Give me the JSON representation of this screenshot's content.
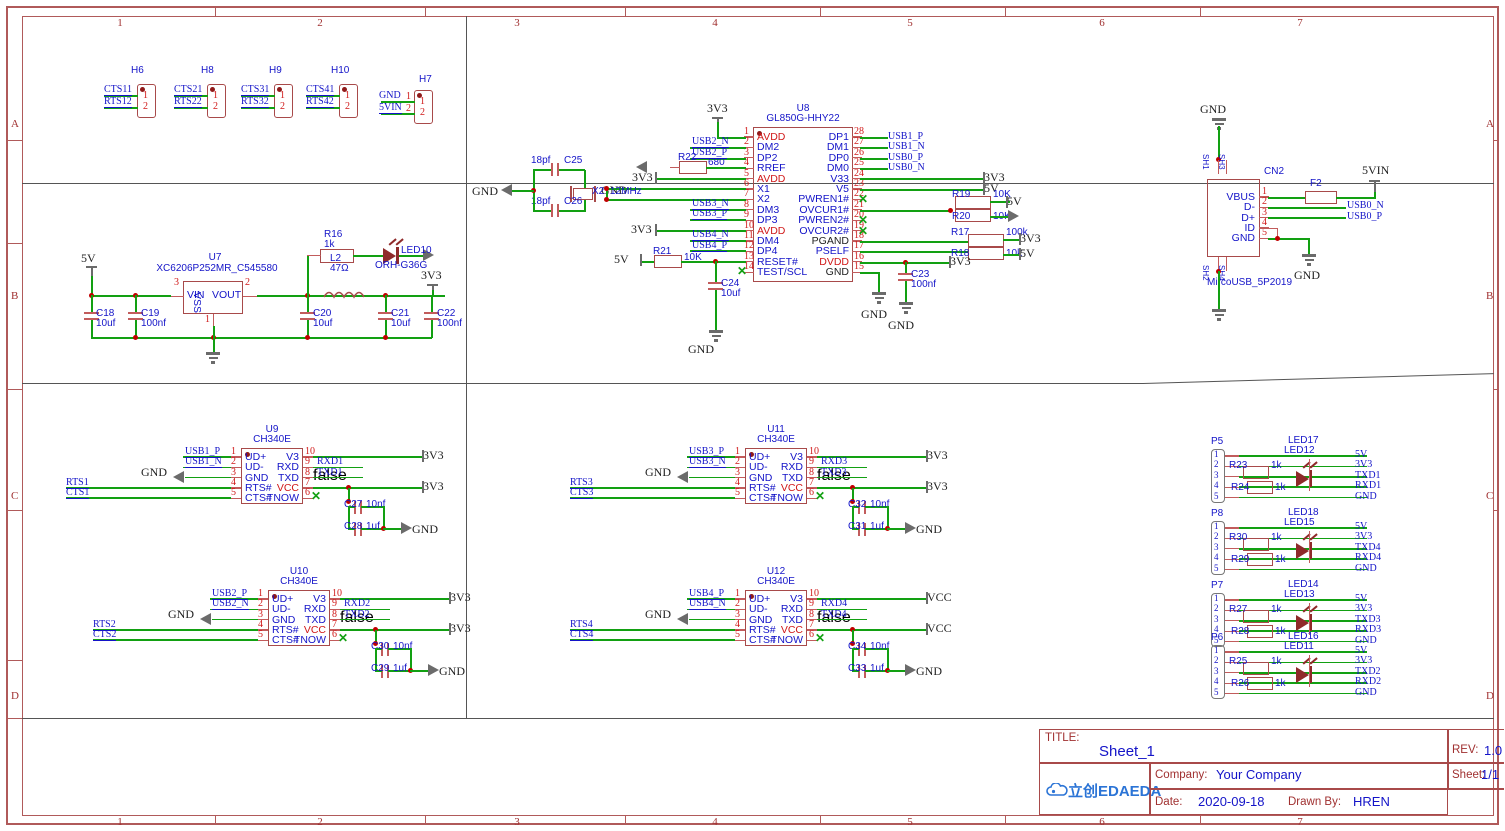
{
  "sheet": {
    "columns": [
      "1",
      "2",
      "3",
      "4",
      "5",
      "6",
      "7"
    ],
    "rows": [
      "A",
      "B",
      "C",
      "D"
    ]
  },
  "title_block": {
    "title_key": "TITLE:",
    "title_value": "Sheet_1",
    "rev_key": "REV:",
    "rev_value": "1.0",
    "company_key": "Company:",
    "company_value": "Your Company",
    "sheet_key": "Sheet:",
    "sheet_value": "1/1",
    "date_key": "Date:",
    "date_value": "2020-09-18",
    "drawn_key": "Drawn By:",
    "drawn_value": "HREN",
    "logo": "立创EDA"
  },
  "headers": [
    {
      "ref": "H6",
      "net_top": "CTS11",
      "net_bot": "RTS12",
      "pin1": "1",
      "pin2": "2"
    },
    {
      "ref": "H8",
      "net_top": "CTS21",
      "net_bot": "RTS22",
      "pin1": "1",
      "pin2": "2"
    },
    {
      "ref": "H9",
      "net_top": "CTS31",
      "net_bot": "RTS32",
      "pin1": "1",
      "pin2": "2"
    },
    {
      "ref": "H10",
      "net_top": "CTS41",
      "net_bot": "RTS42",
      "pin1": "1",
      "pin2": "2"
    },
    {
      "ref": "H7",
      "net_top": "GND",
      "net_bot": "5VIN",
      "pin1": "1",
      "pin2": "2"
    }
  ],
  "regulator": {
    "ref": "U7",
    "part": "XC6206P252MR_C545580",
    "pin_vin": "VIN",
    "pin_vout": "VOUT",
    "pin_vss": "VSS",
    "pin_num_3": "3",
    "pin_num_2": "2",
    "pin_num_1": "1",
    "in_rail": "5V",
    "out_rail": "3V3",
    "caps": [
      {
        "ref": "C18",
        "val": "10uf"
      },
      {
        "ref": "C19",
        "val": "100nf"
      },
      {
        "ref": "C20",
        "val": "10uf"
      },
      {
        "ref": "C21",
        "val": "10uf"
      },
      {
        "ref": "C22",
        "val": "100nf"
      }
    ],
    "r16": {
      "ref": "R16",
      "val": "1k"
    },
    "led10": {
      "ref": "LED10",
      "part": "ORH-G36G"
    },
    "l2": {
      "ref": "L2",
      "val": "47Ω"
    },
    "gnd": "GND"
  },
  "hub": {
    "ref": "U8",
    "part": "GL850G-HHY22",
    "left_pins": [
      {
        "num": "1",
        "name": "AVDD",
        "power": true
      },
      {
        "num": "2",
        "name": "DM2",
        "power": false
      },
      {
        "num": "3",
        "name": "DP2",
        "power": false
      },
      {
        "num": "4",
        "name": "RREF",
        "power": false
      },
      {
        "num": "5",
        "name": "AVDD",
        "power": true
      },
      {
        "num": "6",
        "name": "X1",
        "power": false
      },
      {
        "num": "7",
        "name": "X2",
        "power": false
      },
      {
        "num": "8",
        "name": "DM3",
        "power": false
      },
      {
        "num": "9",
        "name": "DP3",
        "power": false
      },
      {
        "num": "10",
        "name": "AVDD",
        "power": true
      },
      {
        "num": "11",
        "name": "DM4",
        "power": false
      },
      {
        "num": "12",
        "name": "DP4",
        "power": false
      },
      {
        "num": "13",
        "name": "RESET#",
        "power": false
      },
      {
        "num": "14",
        "name": "TEST/SCL",
        "power": false
      }
    ],
    "right_pins": [
      {
        "num": "28",
        "name": "DP1",
        "power": false
      },
      {
        "num": "27",
        "name": "DM1",
        "power": false
      },
      {
        "num": "26",
        "name": "DP0",
        "power": false
      },
      {
        "num": "25",
        "name": "DM0",
        "power": false
      },
      {
        "num": "24",
        "name": "V33",
        "power": false
      },
      {
        "num": "23",
        "name": "V5",
        "power": false
      },
      {
        "num": "22",
        "name": "PWREN1#",
        "power": false
      },
      {
        "num": "21",
        "name": "OVCUR1#",
        "power": false
      },
      {
        "num": "20",
        "name": "PWREN2#",
        "power": false
      },
      {
        "num": "19",
        "name": "OVCUR2#",
        "power": false
      },
      {
        "num": "18",
        "name": "PGAND",
        "power": false,
        "black": true
      },
      {
        "num": "17",
        "name": "PSELF",
        "power": false
      },
      {
        "num": "16",
        "name": "DVDD",
        "power": true
      },
      {
        "num": "15",
        "name": "GND",
        "power": false,
        "black": true
      }
    ],
    "left_nets": {
      "p1": "3V3",
      "p2": "USB2_N",
      "p3": "USB2_P",
      "p5": "3V3",
      "p8": "USB3_N",
      "p9": "USB3_P",
      "p10": "3V3",
      "p11": "USB4_N",
      "p12": "USB4_P",
      "p13": "5V"
    },
    "right_nets": {
      "p28": "USB1_P",
      "p27": "USB1_N",
      "p26": "USB0_P",
      "p25": "USB0_N",
      "p24": "3V3",
      "p23": "5V",
      "p21": "5V",
      "p16": "3V3"
    },
    "r22": {
      "ref": "R22",
      "val": "680"
    },
    "r21": {
      "ref": "R21",
      "val": "10K"
    },
    "r19": {
      "ref": "R19",
      "val": "10K"
    },
    "r20": {
      "ref": "R20",
      "val": "10K"
    },
    "r17": {
      "ref": "R17",
      "val": "100k"
    },
    "r18": {
      "ref": "R18",
      "val": "10k"
    },
    "r17_net": "3V3",
    "r18_net": "5V",
    "c24": {
      "ref": "C24",
      "val": "10uf"
    },
    "c23": {
      "ref": "C23",
      "val": "100nf"
    },
    "c25": {
      "ref": "C25",
      "val": "18pf"
    },
    "c26": {
      "ref": "C26",
      "val": "18pf"
    },
    "xtal": {
      "ref": "X2",
      "val": "12MHz"
    },
    "gnd": "GND",
    "rail_3v3": "3V3"
  },
  "usb_conn": {
    "ref": "CN2",
    "part": "MircoUSB_5P2019",
    "pins": [
      {
        "num": "1",
        "name": "VBUS"
      },
      {
        "num": "2",
        "name": "D-"
      },
      {
        "num": "3",
        "name": "D+"
      },
      {
        "num": "4",
        "name": "ID"
      },
      {
        "num": "5",
        "name": "GND"
      }
    ],
    "shield_top": [
      "SH1",
      "SH3"
    ],
    "shield_bot": [
      "SH2",
      "SH4"
    ],
    "fuse": {
      "ref": "F2"
    },
    "net_5vin": "5VIN",
    "net_dm": "USB0_N",
    "net_dp": "USB0_P",
    "gnd": "GND"
  },
  "uarts": [
    {
      "ref": "U9",
      "part": "CH340E",
      "left_pins": [
        {
          "num": "1",
          "name": "UD+"
        },
        {
          "num": "2",
          "name": "UD-"
        },
        {
          "num": "3",
          "name": "GND"
        },
        {
          "num": "4",
          "name": "RTS#"
        },
        {
          "num": "5",
          "name": "CTS#"
        }
      ],
      "right_pins": [
        {
          "num": "10",
          "name": "V3"
        },
        {
          "num": "9",
          "name": "RXD"
        },
        {
          "num": "8",
          "name": "TXD"
        },
        {
          "num": "7",
          "name": "VCC",
          "power": true
        },
        {
          "num": "6",
          "name": "TNOW"
        }
      ],
      "nets": {
        "p1": "USB1_P",
        "p2": "USB1_N",
        "p4": "RTS1",
        "p5": "CTS1",
        "p9": "RXD1",
        "p8": "TXD1"
      },
      "v3_rail": "3V3",
      "vcc_rail": "3V3",
      "caps": [
        {
          "ref": "C27",
          "val": "10nf"
        },
        {
          "ref": "C28",
          "val": "1uf"
        }
      ],
      "gnd": "GND"
    },
    {
      "ref": "U10",
      "part": "CH340E",
      "left_pins": [
        {
          "num": "1",
          "name": "UD+"
        },
        {
          "num": "2",
          "name": "UD-"
        },
        {
          "num": "3",
          "name": "GND"
        },
        {
          "num": "4",
          "name": "RTS#"
        },
        {
          "num": "5",
          "name": "CTS#"
        }
      ],
      "right_pins": [
        {
          "num": "10",
          "name": "V3"
        },
        {
          "num": "9",
          "name": "RXD"
        },
        {
          "num": "8",
          "name": "TXD"
        },
        {
          "num": "7",
          "name": "VCC",
          "power": true
        },
        {
          "num": "6",
          "name": "TNOW"
        }
      ],
      "nets": {
        "p1": "USB2_P",
        "p2": "USB2_N",
        "p4": "RTS2",
        "p5": "CTS2",
        "p9": "RXD2",
        "p8": "TXD2"
      },
      "v3_rail": "3V3",
      "vcc_rail": "3V3",
      "caps": [
        {
          "ref": "C30",
          "val": "10nf"
        },
        {
          "ref": "C29",
          "val": "1uf"
        }
      ],
      "gnd": "GND"
    },
    {
      "ref": "U11",
      "part": "CH340E",
      "left_pins": [
        {
          "num": "1",
          "name": "UD+"
        },
        {
          "num": "2",
          "name": "UD-"
        },
        {
          "num": "3",
          "name": "GND"
        },
        {
          "num": "4",
          "name": "RTS#"
        },
        {
          "num": "5",
          "name": "CTS#"
        }
      ],
      "right_pins": [
        {
          "num": "10",
          "name": "V3"
        },
        {
          "num": "9",
          "name": "RXD"
        },
        {
          "num": "8",
          "name": "TXD"
        },
        {
          "num": "7",
          "name": "VCC",
          "power": true
        },
        {
          "num": "6",
          "name": "TNOW"
        }
      ],
      "nets": {
        "p1": "USB3_P",
        "p2": "USB3_N",
        "p4": "RTS3",
        "p5": "CTS3",
        "p9": "RXD3",
        "p8": "TXD3"
      },
      "v3_rail": "3V3",
      "vcc_rail": "3V3",
      "caps": [
        {
          "ref": "C32",
          "val": "10nf"
        },
        {
          "ref": "C31",
          "val": "1uf"
        }
      ],
      "gnd": "GND"
    },
    {
      "ref": "U12",
      "part": "CH340E",
      "left_pins": [
        {
          "num": "1",
          "name": "UD+"
        },
        {
          "num": "2",
          "name": "UD-"
        },
        {
          "num": "3",
          "name": "GND"
        },
        {
          "num": "4",
          "name": "RTS#"
        },
        {
          "num": "5",
          "name": "CTS#"
        }
      ],
      "right_pins": [
        {
          "num": "10",
          "name": "V3"
        },
        {
          "num": "9",
          "name": "RXD"
        },
        {
          "num": "8",
          "name": "TXD"
        },
        {
          "num": "7",
          "name": "VCC",
          "power": true
        },
        {
          "num": "6",
          "name": "TNOW"
        }
      ],
      "nets": {
        "p1": "USB4_P",
        "p2": "USB4_N",
        "p4": "RTS4",
        "p5": "CTS4",
        "p9": "RXD4",
        "p8": "TXD4"
      },
      "v3_rail": "VCC",
      "vcc_rail": "VCC",
      "caps": [
        {
          "ref": "C34",
          "val": "10nf"
        },
        {
          "ref": "C33",
          "val": "1uf"
        }
      ],
      "gnd": "GND"
    }
  ],
  "port_blocks": [
    {
      "ref": "P5",
      "leds": [
        "LED17",
        "LED12"
      ],
      "resistors": [
        {
          "ref": "R23",
          "val": "1k"
        },
        {
          "ref": "R24",
          "val": "1k"
        }
      ],
      "pins": [
        "1",
        "2",
        "3",
        "4",
        "5"
      ],
      "nets": [
        "5V",
        "3V3",
        "TXD1",
        "RXD1",
        "GND"
      ]
    },
    {
      "ref": "P8",
      "leds": [
        "LED18",
        "LED15"
      ],
      "resistors": [
        {
          "ref": "R30",
          "val": "1k"
        },
        {
          "ref": "R29",
          "val": "1k"
        }
      ],
      "pins": [
        "1",
        "2",
        "3",
        "4",
        "5"
      ],
      "nets": [
        "5V",
        "3V3",
        "TXD4",
        "RXD4",
        "GND"
      ]
    },
    {
      "ref": "P7",
      "leds": [
        "LED14",
        "LED13"
      ],
      "resistors": [
        {
          "ref": "R27",
          "val": "1k"
        },
        {
          "ref": "R28",
          "val": "1k"
        }
      ],
      "pins": [
        "1",
        "2",
        "3",
        "4",
        "5"
      ],
      "nets": [
        "5V",
        "3V3",
        "TXD3",
        "RXD3",
        "GND"
      ]
    },
    {
      "ref": "P6",
      "leds": [
        "LED16",
        "LED11"
      ],
      "resistors": [
        {
          "ref": "R25",
          "val": "1k"
        },
        {
          "ref": "R26",
          "val": "1k"
        }
      ],
      "pins": [
        "1",
        "2",
        "3",
        "4",
        "5"
      ],
      "nets": [
        "5V",
        "3V3",
        "TXD2",
        "RXD2",
        "GND"
      ]
    }
  ]
}
